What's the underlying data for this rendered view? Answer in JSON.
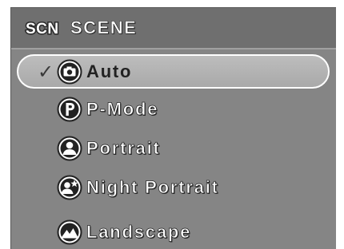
{
  "header": {
    "badge_text": "SCN",
    "title": "SCENE"
  },
  "menu": {
    "check_mark": "✓",
    "items": [
      {
        "label": "Auto",
        "icon": "camera-icon",
        "selected": true
      },
      {
        "label": "P-Mode",
        "icon": "p-mode-icon",
        "selected": false
      },
      {
        "label": "Portrait",
        "icon": "portrait-icon",
        "selected": false
      },
      {
        "label": "Night Portrait",
        "icon": "night-portrait-icon",
        "selected": false
      },
      {
        "label": "Landscape",
        "icon": "landscape-icon",
        "selected": false
      }
    ]
  },
  "colors": {
    "panel": "#858585",
    "header": "#6f6f6f",
    "selection": "#b5b5b5",
    "text": "#ffffff"
  }
}
